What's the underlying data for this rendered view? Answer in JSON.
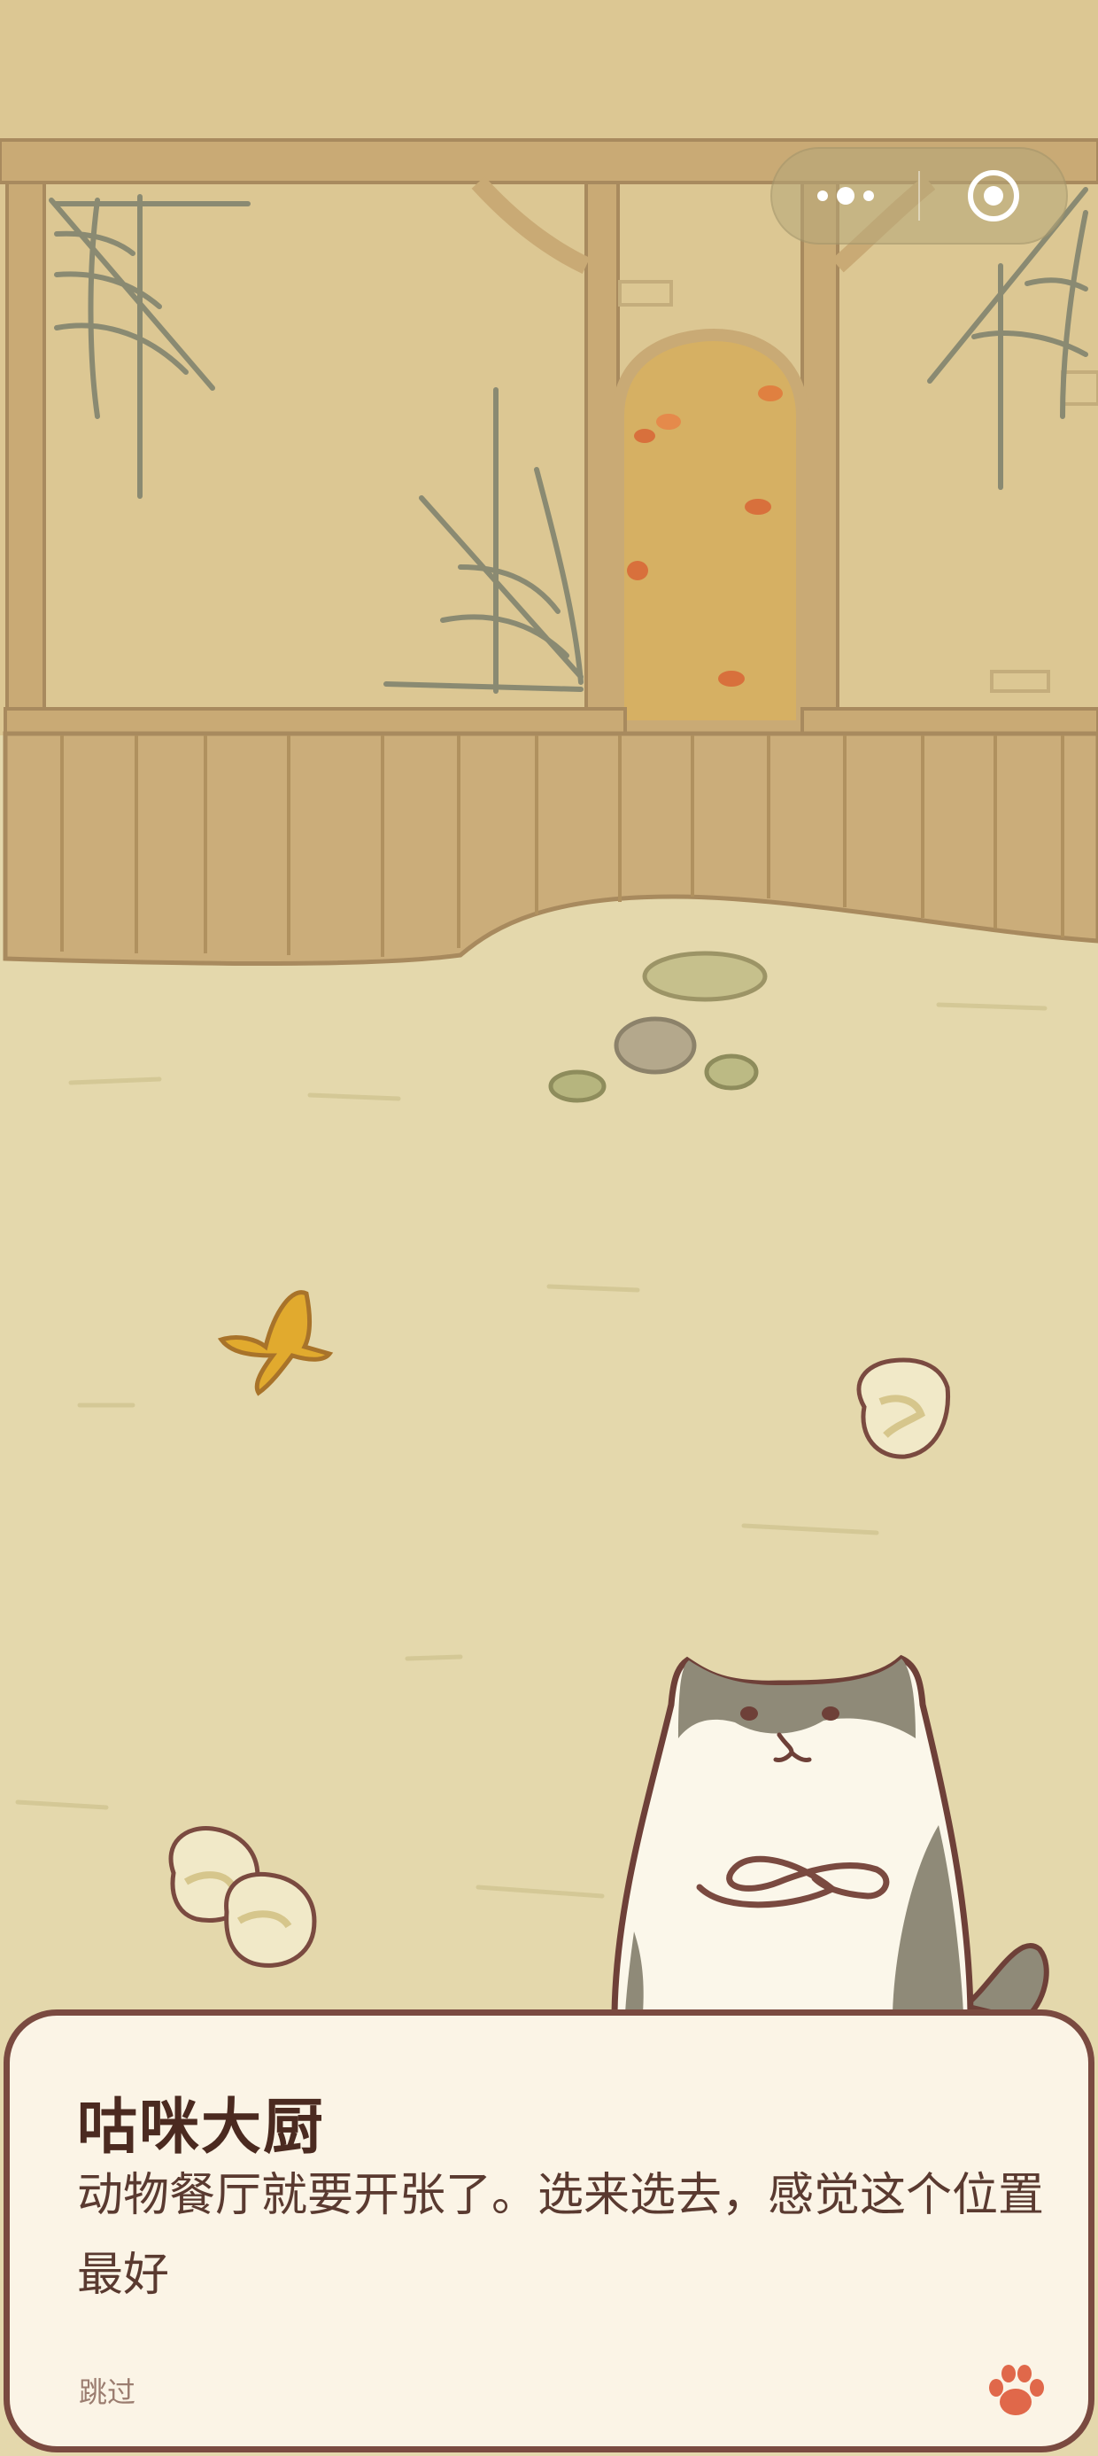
{
  "capsule": {
    "menu_icon": "more-dots-icon",
    "close_icon": "target-close-icon"
  },
  "dialog": {
    "speaker": "咕咪大厨",
    "text": "动物餐厅就要开张了。选来选去，感觉这个位置最好",
    "skip": "跳过",
    "next_icon": "paw-icon"
  },
  "colors": {
    "wall": "#dcc793",
    "beam": "#c9aa75",
    "ground": "#e4d8ac",
    "doorway": "#d6b063",
    "dialog_bg": "#fbf4e6",
    "dialog_border": "#7a4a40",
    "speaker_text": "#4b2a20",
    "paw": "#e0684a"
  }
}
